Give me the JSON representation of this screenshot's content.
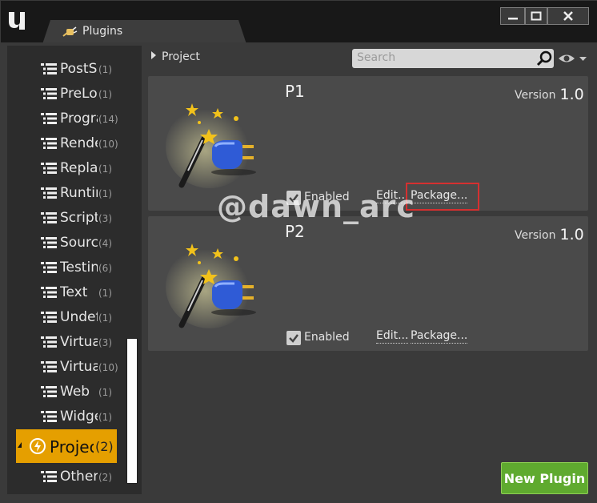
{
  "window": {
    "tab_label": "Plugins",
    "tab_close": "×",
    "min_glyph": "—",
    "max_glyph": "▭",
    "close_glyph": "✕"
  },
  "toolbar": {
    "breadcrumb": "Project",
    "search_placeholder": "Search"
  },
  "sidebar": {
    "categories": [
      {
        "name": "PostSplashScreen",
        "count": "(1)"
      },
      {
        "name": "PreLoadingScreen",
        "count": "(1)"
      },
      {
        "name": "Programming",
        "count": "(14)"
      },
      {
        "name": "Rendering",
        "count": "(10)"
      },
      {
        "name": "Replay",
        "count": "(1)"
      },
      {
        "name": "Runtime",
        "count": "(1)"
      },
      {
        "name": "Scripting",
        "count": "(3)"
      },
      {
        "name": "Source Control",
        "count": "(4)"
      },
      {
        "name": "Testing",
        "count": "(6)"
      },
      {
        "name": "Text",
        "count": "(1)"
      },
      {
        "name": "Undefined",
        "count": "(1)"
      },
      {
        "name": "Virtual Reality",
        "count": "(3)"
      },
      {
        "name": "Virtual",
        "count": "(10)"
      },
      {
        "name": "Web",
        "count": "(1)"
      },
      {
        "name": "Widgets",
        "count": "(1)"
      }
    ],
    "selected": {
      "name": "Project",
      "count": "(2)"
    },
    "other": {
      "name": "Other",
      "count": "(2)"
    }
  },
  "plugins": [
    {
      "name": "P1",
      "version_label": "Version",
      "version": "1.0",
      "enabled_label": "Enabled",
      "enabled": true,
      "edit": "Edit...",
      "package": "Package..."
    },
    {
      "name": "P2",
      "version_label": "Version",
      "version": "1.0",
      "enabled_label": "Enabled",
      "enabled": true,
      "edit": "Edit...",
      "package": "Package..."
    }
  ],
  "new_plugin_label": "New Plugin",
  "watermark": "@dawn_arc",
  "colors": {
    "accent_selected": "#e59f00",
    "new_plugin_green": "#5faa2f",
    "highlight_red": "#d53030"
  }
}
